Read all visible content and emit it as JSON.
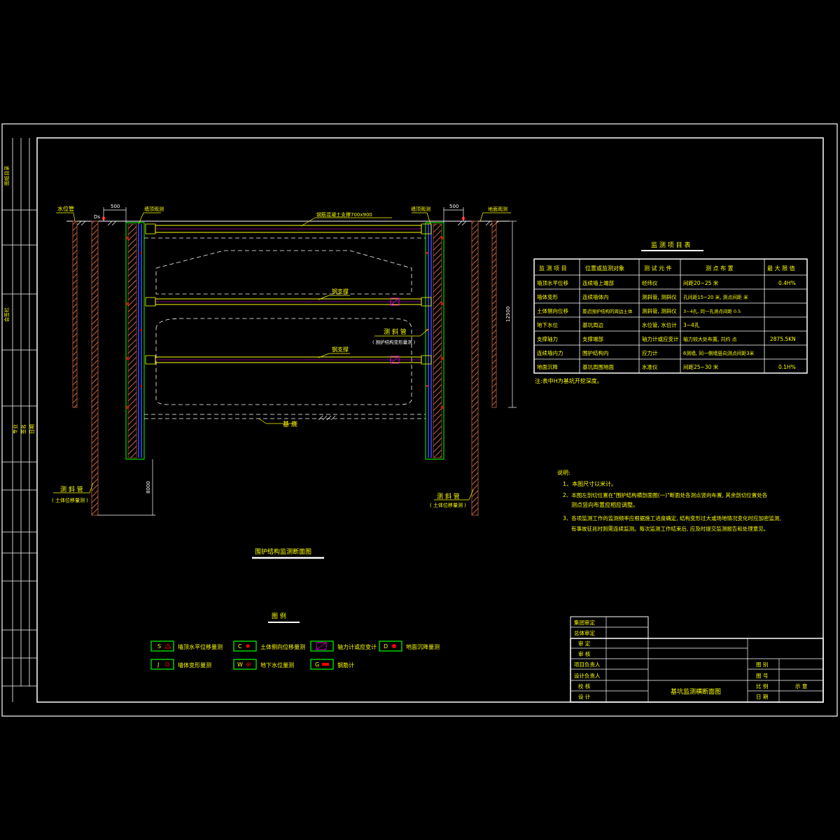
{
  "drawing": {
    "title": "基坑监测横断面图",
    "section_caption": "围护结构监测断面图",
    "legend_title": "图 例"
  },
  "section": {
    "label_water_pipe": "水位管",
    "label_wall_top_left": "墙顶观测",
    "label_wall_top_right": "墙顶观测",
    "label_ground_right": "地面观测",
    "label_concrete_support": "钢筋混凝土支撑700x900",
    "label_steel_support_1": "钢支撑",
    "label_steel_support_2": "钢支撑",
    "label_inclinometer": "测 斜 管",
    "label_inclinometer_note": "( 围护结构变形量测 )",
    "label_pit_bottom": "基 底",
    "label_left_pipe": "测 斜 管",
    "label_left_pipe_note": "( 土体位移量测 )",
    "label_right_pipe": "测 斜 管",
    "label_right_pipe_note": "( 土体位移量测 )",
    "dim_500_left": "500",
    "dim_500_right": "500",
    "dim_ds": "Ds",
    "dim_12500": "12500",
    "dim_8000": "8000"
  },
  "table": {
    "title": "监 测 项 目 表",
    "headers": [
      "监 测 项 目",
      "位置或监测对象",
      "测 试 元 件",
      "测 点 布 置",
      "最 大 限 值"
    ],
    "rows": [
      [
        "墙顶水平位移",
        "连续墙上端部",
        "经纬仪",
        "间距20~25 米",
        "0.4H%"
      ],
      [
        "墙体变形",
        "连续墙体内",
        "测斜管, 测斜仪",
        "孔间距15~20 米, 测点间距 米",
        ""
      ],
      [
        "土体侧向位移",
        "靠近围护结构的周边土体",
        "测斜管, 测斜仪",
        "3~4孔, 同一孔测点间距 0.5",
        ""
      ],
      [
        "地下水位",
        "基坑周边",
        "水位管, 水位计",
        "3~4孔",
        ""
      ],
      [
        "支撑轴力",
        "支撑端部",
        "轴力计或应变计",
        "轴力较大处布置, 共约 点",
        "2875.5KN"
      ],
      [
        "连续墙内力",
        "围护结构内",
        "应力计",
        "6测墙, 同一侧墙竖向测点间距3米",
        ""
      ],
      [
        "地面沉降",
        "基坑周围地面",
        "水准仪",
        "间距25~30 米",
        "0.1H%"
      ]
    ],
    "note": "注:表中H为基坑开挖深度。"
  },
  "notes": {
    "title": "说明:",
    "lines": [
      "1、本图尺寸以米计。",
      "2、本图左剖切位置在\"围护结构横剖面图(一)\"断面处各测点竖向布置, 其余剖切位置处各",
      "测点竖向布置应相应调整。",
      "3、各项监测工作的监测频率应根据施工进度确定, 结构变形过大或场地情况变化时应加密监测,",
      "有事故征兆时则需连续监测。每次监测工作结束后, 应及时提交监测报告和处理意见。"
    ]
  },
  "legend": {
    "items": [
      {
        "code": "S",
        "label": "墙顶水平位移量测"
      },
      {
        "code": "C",
        "label": "土体侧向位移量测"
      },
      {
        "code": "",
        "label": "轴力计或应变计"
      },
      {
        "code": "D",
        "label": "地面沉降量测"
      },
      {
        "code": "J",
        "label": "墙体变形量测"
      },
      {
        "code": "W",
        "label": "地下水位量测"
      },
      {
        "code": "G",
        "label": "钢筋计"
      }
    ]
  },
  "titleblock": {
    "row_review": "集团审定",
    "row_verify": "总体审定",
    "row_approve": "审 定",
    "row_check": "审 核",
    "row_pm": "项目负责人",
    "row_lead": "设计负责人",
    "row_checker": "校 核",
    "row_designer": "设 计",
    "field_sheet": "图 别",
    "field_number": "图 号",
    "field_scale": "比 例",
    "scale_value": "示 意",
    "field_date": "日 期"
  },
  "sidebar": {
    "col_texts": [
      "图纸目录",
      "会签栏",
      "专业",
      "签名",
      "日期"
    ]
  },
  "colors": {
    "background": "#000000",
    "line": "#ffffff",
    "text_primary": "#ffff00",
    "wall_fill": "#c8643c",
    "support": "#ffff00",
    "blue": "#3c50ff",
    "green": "#00ff00",
    "red_marker": "#ff0000",
    "magenta": "#ff00ff"
  }
}
